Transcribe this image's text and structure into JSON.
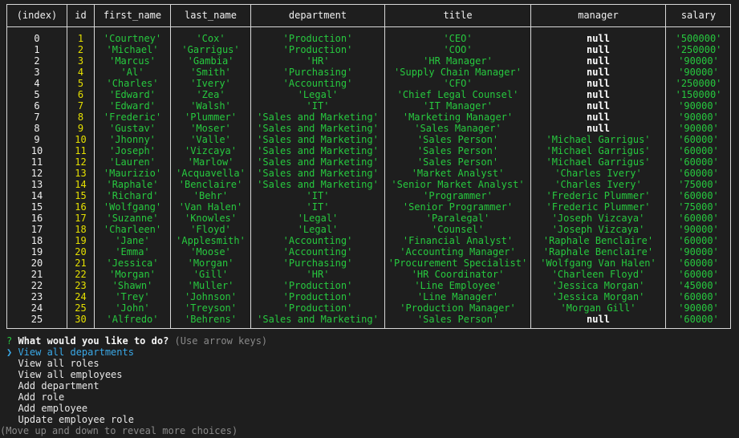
{
  "headers": [
    "(index)",
    "id",
    "first_name",
    "last_name",
    "department",
    "title",
    "manager",
    "salary"
  ],
  "rows": [
    [
      "0",
      "1",
      "'Courtney'",
      "'Cox'",
      "'Production'",
      "'CEO'",
      "null",
      "'500000'"
    ],
    [
      "1",
      "2",
      "'Michael'",
      "'Garrigus'",
      "'Production'",
      "'COO'",
      "null",
      "'250000'"
    ],
    [
      "2",
      "3",
      "'Marcus'",
      "'Gambia'",
      "'HR'",
      "'HR Manager'",
      "null",
      "'90000'"
    ],
    [
      "3",
      "4",
      "'Al'",
      "'Smith'",
      "'Purchasing'",
      "'Supply Chain Manager'",
      "null",
      "'90000'"
    ],
    [
      "4",
      "5",
      "'Charles'",
      "'Ivery'",
      "'Accounting'",
      "'CFO'",
      "null",
      "'250000'"
    ],
    [
      "5",
      "6",
      "'Edward'",
      "'Zea'",
      "'Legal'",
      "'Chief Legal Counsel'",
      "null",
      "'150000'"
    ],
    [
      "6",
      "7",
      "'Edward'",
      "'Walsh'",
      "'IT'",
      "'IT Manager'",
      "null",
      "'90000'"
    ],
    [
      "7",
      "8",
      "'Frederic'",
      "'Plummer'",
      "'Sales and Marketing'",
      "'Marketing Manager'",
      "null",
      "'90000'"
    ],
    [
      "8",
      "9",
      "'Gustav'",
      "'Moser'",
      "'Sales and Marketing'",
      "'Sales Manager'",
      "null",
      "'90000'"
    ],
    [
      "9",
      "10",
      "'Jhonny'",
      "'Valle'",
      "'Sales and Marketing'",
      "'Sales Person'",
      "'Michael Garrigus'",
      "'60000'"
    ],
    [
      "10",
      "11",
      "'Joseph'",
      "'Vizcaya'",
      "'Sales and Marketing'",
      "'Sales Person'",
      "'Michael Garrigus'",
      "'60000'"
    ],
    [
      "11",
      "12",
      "'Lauren'",
      "'Marlow'",
      "'Sales and Marketing'",
      "'Sales Person'",
      "'Michael Garrigus'",
      "'60000'"
    ],
    [
      "12",
      "13",
      "'Maurizio'",
      "'Acquavella'",
      "'Sales and Marketing'",
      "'Market Analyst'",
      "'Charles Ivery'",
      "'60000'"
    ],
    [
      "13",
      "14",
      "'Raphale'",
      "'Benclaire'",
      "'Sales and Marketing'",
      "'Senior Market Analyst'",
      "'Charles Ivery'",
      "'75000'"
    ],
    [
      "14",
      "15",
      "'Richard'",
      "'Behr'",
      "'IT'",
      "'Programmer'",
      "'Frederic Plummer'",
      "'60000'"
    ],
    [
      "15",
      "16",
      "'Wolfgang'",
      "'Van Halen'",
      "'IT'",
      "'Senior Programmer'",
      "'Frederic Plummer'",
      "'75000'"
    ],
    [
      "16",
      "17",
      "'Suzanne'",
      "'Knowles'",
      "'Legal'",
      "'Paralegal'",
      "'Joseph Vizcaya'",
      "'60000'"
    ],
    [
      "17",
      "18",
      "'Charleen'",
      "'Floyd'",
      "'Legal'",
      "'Counsel'",
      "'Joseph Vizcaya'",
      "'90000'"
    ],
    [
      "18",
      "19",
      "'Jane'",
      "'Applesmith'",
      "'Accounting'",
      "'Financial Analyst'",
      "'Raphale Benclaire'",
      "'60000'"
    ],
    [
      "19",
      "20",
      "'Emma'",
      "'Moose'",
      "'Accounting'",
      "'Accounting Manager'",
      "'Raphale Benclaire'",
      "'90000'"
    ],
    [
      "20",
      "21",
      "'Jessica'",
      "'Morgan'",
      "'Purchasing'",
      "'Procurement Specialist'",
      "'Wolfgang Van Halen'",
      "'60000'"
    ],
    [
      "21",
      "22",
      "'Morgan'",
      "'Gill'",
      "'HR'",
      "'HR Coordinator'",
      "'Charleen Floyd'",
      "'60000'"
    ],
    [
      "22",
      "23",
      "'Shawn'",
      "'Muller'",
      "'Production'",
      "'Line Employee'",
      "'Jessica Morgan'",
      "'45000'"
    ],
    [
      "23",
      "24",
      "'Trey'",
      "'Johnson'",
      "'Production'",
      "'Line Manager'",
      "'Jessica Morgan'",
      "'60000'"
    ],
    [
      "24",
      "25",
      "'John'",
      "'Treyson'",
      "'Production'",
      "'Production Manager'",
      "'Morgan Gill'",
      "'90000'"
    ],
    [
      "25",
      "30",
      "'Alfredo'",
      "'Behrens'",
      "'Sales and Marketing'",
      "'Sales Person'",
      "null",
      "'60000'"
    ]
  ],
  "prompt": {
    "mark": "?",
    "question": "What would you like to do?",
    "hint": "(Use arrow keys)",
    "pointer": "❯",
    "choices": [
      "View all departments",
      "View all roles",
      "View all employees",
      "Add department",
      "Add role",
      "Add employee",
      "Update employee role"
    ],
    "selected_index": 0,
    "footer": "(Move up and down to reveal more choices)"
  },
  "colors": {
    "background": "#1e1e1e",
    "index": "#f0f0f0",
    "id": "#e5e000",
    "string": "#27c93f",
    "null": "#ffffff",
    "selected": "#3aa9e8",
    "hint": "#8a8a8a"
  }
}
